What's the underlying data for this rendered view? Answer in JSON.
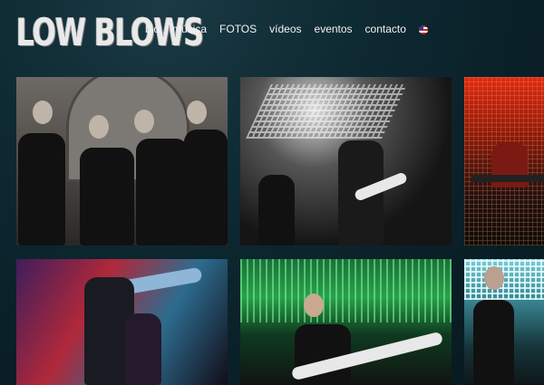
{
  "brand": {
    "logo_text": "LOW BLOWS"
  },
  "nav": {
    "items": [
      {
        "label": "bio"
      },
      {
        "label": "música"
      },
      {
        "label": "FOTOS"
      },
      {
        "label": "vídeos"
      },
      {
        "label": "eventos"
      },
      {
        "label": "contacto"
      }
    ],
    "language_icon": "uk-flag-icon"
  },
  "gallery": {
    "photos": [
      {
        "subject": "band-portrait"
      },
      {
        "subject": "live-stage-bw"
      },
      {
        "subject": "keyboard-red-lights"
      },
      {
        "subject": "bass-purple-lights"
      },
      {
        "subject": "singer-green-lights"
      },
      {
        "subject": "guitarist-cyan-lights"
      }
    ]
  }
}
